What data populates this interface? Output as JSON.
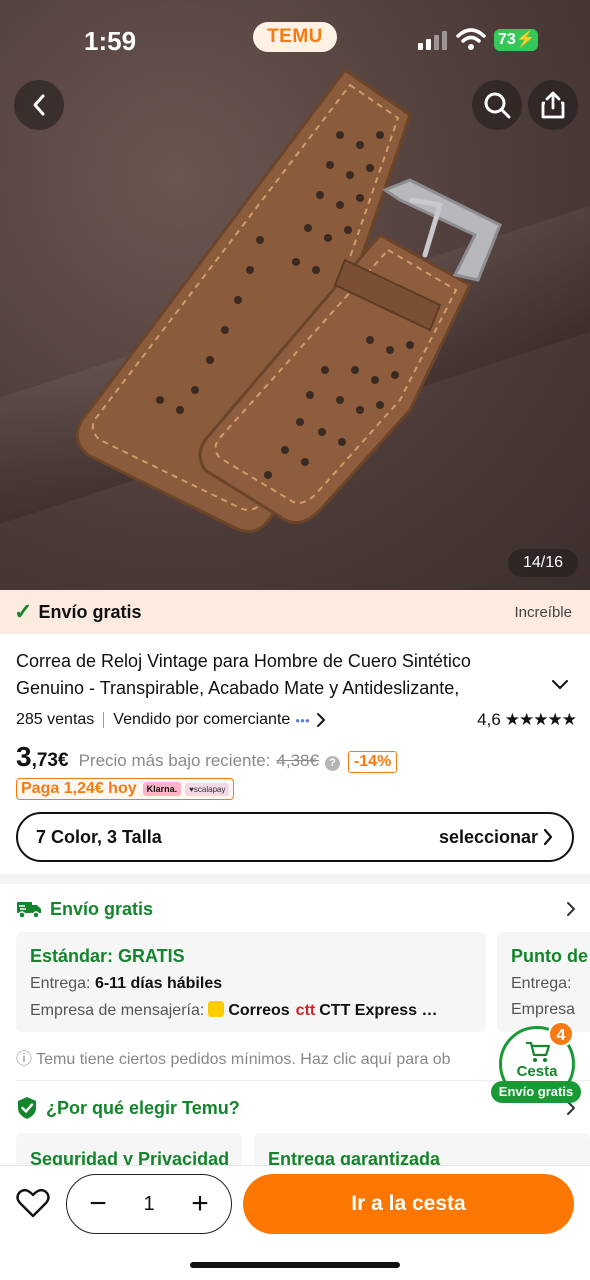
{
  "status_bar": {
    "time": "1:59",
    "app_badge": "TEMU",
    "battery": "73"
  },
  "gallery": {
    "counter": "14/16"
  },
  "shipping_bar": {
    "label": "Envío gratis",
    "tag": "Increíble"
  },
  "product": {
    "title": "Correa de Reloj Vintage para Hombre de Cuero Sintético Genuino - Transpirable, Acabado Mate y Antideslizante,",
    "sales": "285 ventas",
    "seller": "Vendido por comerciante",
    "rating": "4,6",
    "stars": "★★★★★",
    "price_int": "3",
    "price_dec": ",73€",
    "prev_label": "Precio más bajo reciente:",
    "prev_price": "4,38€",
    "discount": "-14%",
    "pay_today": "Paga 1,24€ hoy",
    "klarna": "Klarna.",
    "scalapay": "♥scalapay"
  },
  "variant": {
    "label": "7 Color, 3 Talla",
    "action": "seleccionar"
  },
  "shipping": {
    "title": "Envío gratis",
    "standard": {
      "title": "Estándar: GRATIS",
      "delivery_label": "Entrega:",
      "delivery_value": "6-11 días hábiles",
      "courier_label": "Empresa de mensajería:",
      "courier_1": "Correos",
      "courier_ctt": "ctt",
      "courier_2": "CTT Express …"
    },
    "pickup": {
      "title": "Punto de",
      "delivery_label": "Entrega:",
      "courier_label": "Empresa"
    },
    "notice": "ⓘ Temu tiene ciertos pedidos mínimos. Haz clic aquí para ob"
  },
  "why": {
    "title": "¿Por qué elegir Temu?",
    "benefits": [
      "Seguridad y Privacidad",
      "Entrega garantizada"
    ]
  },
  "cart_float": {
    "count": "4",
    "label": "Cesta",
    "free": "Envío gratis"
  },
  "bottom": {
    "qty": "1",
    "minus": "−",
    "plus": "+",
    "go_cart": "Ir a la cesta"
  }
}
